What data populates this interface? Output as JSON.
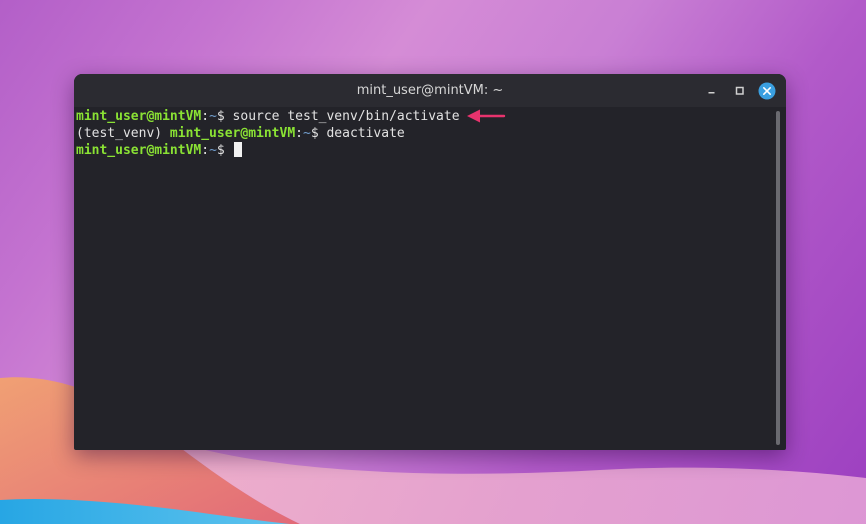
{
  "window": {
    "title": "mint_user@mintVM: ~"
  },
  "terminal": {
    "line1": {
      "prompt_user": "mint_user@mintVM",
      "prompt_colon": ":",
      "prompt_path": "~",
      "prompt_symbol": "$ ",
      "command": "source test_venv/bin/activate"
    },
    "line2": {
      "env_prefix": "(test_venv) ",
      "prompt_user": "mint_user@mintVM",
      "prompt_colon": ":",
      "prompt_path": "~",
      "prompt_symbol": "$ ",
      "command": "deactivate"
    },
    "line3": {
      "prompt_user": "mint_user@mintVM",
      "prompt_colon": ":",
      "prompt_path": "~",
      "prompt_symbol": "$ "
    }
  },
  "colors": {
    "prompt_user": "#8ae234",
    "prompt_path": "#729fcf",
    "terminal_bg": "#232329",
    "close_button": "#3a9fe0",
    "annotation_arrow": "#e8336d"
  },
  "icons": {
    "minimize": "minimize-icon",
    "maximize": "maximize-icon",
    "close": "close-icon",
    "annotation": "arrow-left-icon"
  }
}
